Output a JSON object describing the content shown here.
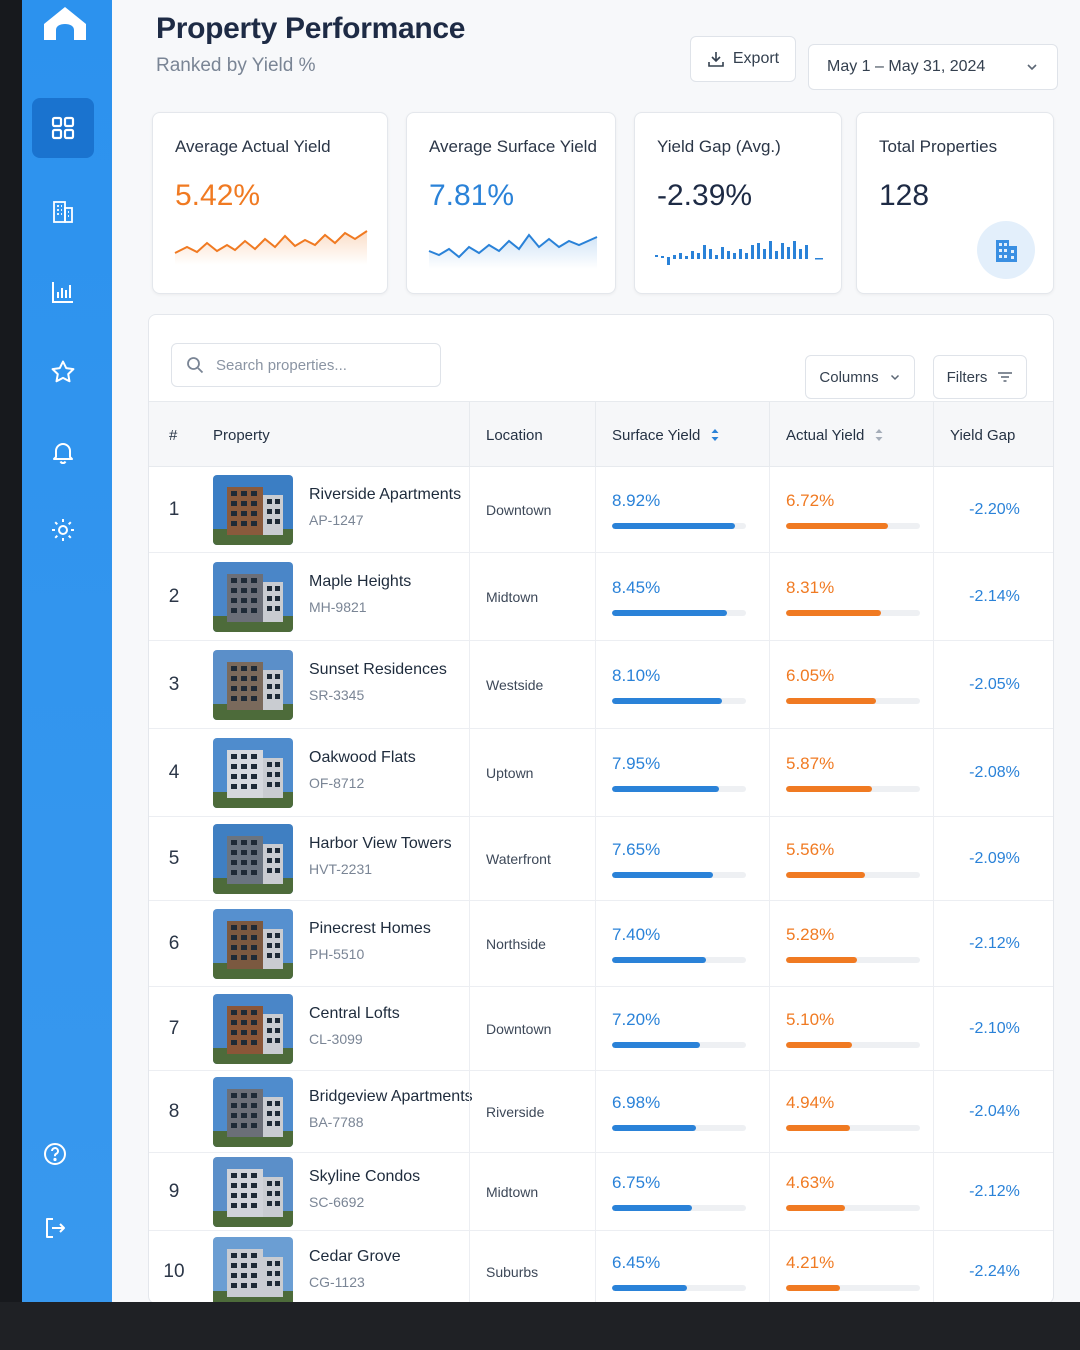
{
  "header": {
    "title": "Property Performance",
    "subtitle": "Ranked by Yield %",
    "export_label": "Export",
    "date_range": "May 1 – May 31, 2024"
  },
  "sidebar": {
    "items": [
      {
        "icon": "grid-icon",
        "active": true
      },
      {
        "icon": "building-icon",
        "active": false
      },
      {
        "icon": "bar-chart-icon",
        "active": false
      },
      {
        "icon": "star-icon",
        "active": false
      },
      {
        "icon": "bell-icon",
        "active": false
      },
      {
        "icon": "gear-icon",
        "active": false
      }
    ],
    "bottom": [
      {
        "icon": "help-icon"
      },
      {
        "icon": "logout-icon"
      }
    ]
  },
  "kpis": [
    {
      "label": "Average Actual Yield",
      "value": "5.42%",
      "color": "#f07a22"
    },
    {
      "label": "Average Surface Yield",
      "value": "7.81%",
      "color": "#2a82d8"
    },
    {
      "label": "Yield Gap (Avg.)",
      "value": "-2.39%",
      "color": "#1e2b45"
    },
    {
      "label": "Total Properties",
      "value": "128",
      "color": "#1e2b45"
    }
  ],
  "table": {
    "search_placeholder": "Search properties...",
    "columns_label": "Columns",
    "filters_label": "Filters",
    "headers": {
      "rank": "#",
      "property": "Property",
      "location": "Location",
      "surface": "Surface Yield",
      "actual": "Actual Yield",
      "gap": "Yield Gap"
    },
    "rows": [
      {
        "rank": "1",
        "name": "Riverside Apartments",
        "code": "AP-1247",
        "location": "Downtown",
        "surface": "8.92%",
        "surface_pct": 92,
        "actual": "6.72%",
        "actual_pct": 76,
        "gap": "-2.20%"
      },
      {
        "rank": "2",
        "name": "Maple Heights",
        "code": "MH-9821",
        "location": "Midtown",
        "surface": "8.45%",
        "surface_pct": 86,
        "actual": "8.31%",
        "actual_pct": 71,
        "gap": "-2.14%"
      },
      {
        "rank": "3",
        "name": "Sunset Residences",
        "code": "SR-3345",
        "location": "Westside",
        "surface": "8.10%",
        "surface_pct": 82,
        "actual": "6.05%",
        "actual_pct": 67,
        "gap": "-2.05%"
      },
      {
        "rank": "4",
        "name": "Oakwood Flats",
        "code": "OF-8712",
        "location": "Uptown",
        "surface": "7.95%",
        "surface_pct": 80,
        "actual": "5.87%",
        "actual_pct": 64,
        "gap": "-2.08%"
      },
      {
        "rank": "5",
        "name": "Harbor View Towers",
        "code": "HVT-2231",
        "location": "Waterfront",
        "surface": "7.65%",
        "surface_pct": 75,
        "actual": "5.56%",
        "actual_pct": 59,
        "gap": "-2.09%"
      },
      {
        "rank": "6",
        "name": "Pinecrest Homes",
        "code": "PH-5510",
        "location": "Northside",
        "surface": "7.40%",
        "surface_pct": 70,
        "actual": "5.28%",
        "actual_pct": 53,
        "gap": "-2.12%"
      },
      {
        "rank": "7",
        "name": "Central Lofts",
        "code": "CL-3099",
        "location": "Downtown",
        "surface": "7.20%",
        "surface_pct": 66,
        "actual": "5.10%",
        "actual_pct": 49,
        "gap": "-2.10%"
      },
      {
        "rank": "8",
        "name": "Bridgeview Apartments",
        "code": "BA-7788",
        "location": "Riverside",
        "surface": "6.98%",
        "surface_pct": 63,
        "actual": "4.94%",
        "actual_pct": 48,
        "gap": "-2.04%"
      },
      {
        "rank": "9",
        "name": "Skyline Condos",
        "code": "SC-6692",
        "location": "Midtown",
        "surface": "6.75%",
        "surface_pct": 60,
        "actual": "4.63%",
        "actual_pct": 44,
        "gap": "-2.12%"
      },
      {
        "rank": "10",
        "name": "Cedar Grove",
        "code": "CG-1123",
        "location": "Suburbs",
        "surface": "6.45%",
        "surface_pct": 56,
        "actual": "4.21%",
        "actual_pct": 40,
        "gap": "-2.24%"
      }
    ]
  },
  "colors": {
    "accent_blue": "#2a82d8",
    "accent_orange": "#f07a22",
    "sidebar": "#2c92ee"
  }
}
